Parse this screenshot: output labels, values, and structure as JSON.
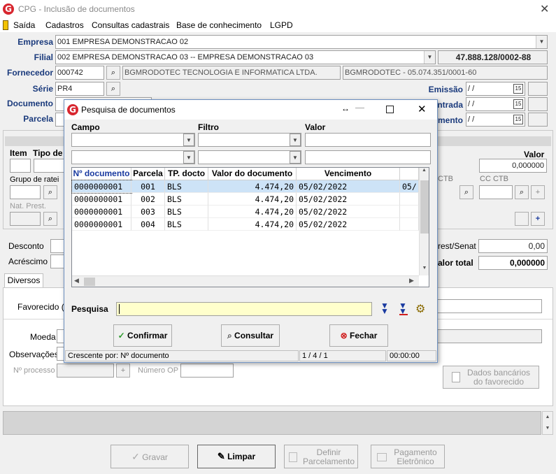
{
  "window": {
    "title": "CPG - Inclusão de documentos"
  },
  "menu": [
    "Saída",
    "Cadastros",
    "Consultas cadastrais",
    "Base de conhecimento",
    "LGPD"
  ],
  "form": {
    "empresa_label": "Empresa",
    "empresa_value": "001 EMPRESA DEMONSTRACAO 02",
    "filial_label": "Filial",
    "filial_value": "002 EMPRESA DEMONSTRACAO 03 -- EMPRESA DEMONSTRACAO 03",
    "filial_cnpj": "47.888.128/0002-88",
    "fornecedor_label": "Fornecedor",
    "fornecedor_code": "000742",
    "fornecedor_name": "BGMRODOTEC TECNOLOGIA E INFORMATICA LTDA.",
    "fornecedor_doc": "BGMRODOTEC - 05.074.351/0001-60",
    "serie_label": "Série",
    "serie_value": "PR4",
    "documento_label": "Documento",
    "parcela_label": "Parcela",
    "emissao_label": "Emissão",
    "entrada_label": "ntrada",
    "vencimento_label": "mento",
    "date_empty": "/ /"
  },
  "items": {
    "item_label": "Item",
    "tipo_label": "Tipo de",
    "valor_label": "Valor",
    "valor_value": "0,000000",
    "grupo_label": "Grupo de ratei",
    "ctb_label": "CTB",
    "cc_ctb_label": "CC CTB",
    "nat_label": "Nat. Prest."
  },
  "totals": {
    "desconto_label": "Desconto",
    "acrescimo_label": "Acréscimo",
    "sest_label": "rest/Senat",
    "sest_value": "0,00",
    "total_label": "alor total",
    "total_value": "0,000000"
  },
  "tabs": {
    "diversos": "Diversos"
  },
  "diversos": {
    "favorecido_label": "Favorecido ( F",
    "moeda_label": "Moeda",
    "obs_label": "Observações",
    "processo_label": "Nº processo",
    "numero_op_label": "Número OP",
    "dados_bancarios": [
      "Dados bancários",
      "do favorecido"
    ]
  },
  "bottom_buttons": {
    "gravar": "Gravar",
    "limpar": "Limpar",
    "definir": [
      "Definir",
      "Parcelamento"
    ],
    "pagamento": [
      "Pagamento",
      "Eletrônico"
    ]
  },
  "dialog": {
    "title": "Pesquisa de documentos",
    "campo_label": "Campo",
    "filtro_label": "Filtro",
    "valor_label": "Valor",
    "columns": [
      "Nº documento",
      "Parcela",
      "TP. docto",
      "Valor do documento",
      "Vencimento",
      ""
    ],
    "rows": [
      [
        "0000000001",
        "001",
        "BLS",
        "4.474,20",
        "05/02/2022",
        "05/"
      ],
      [
        "0000000001",
        "002",
        "BLS",
        "4.474,20",
        "05/02/2022",
        ""
      ],
      [
        "0000000001",
        "003",
        "BLS",
        "4.474,20",
        "05/02/2022",
        ""
      ],
      [
        "0000000001",
        "004",
        "BLS",
        "4.474,20",
        "05/02/2022",
        ""
      ]
    ],
    "pesquisa_label": "Pesquisa",
    "confirmar": "Confirmar",
    "consultar": "Consultar",
    "fechar": "Fechar",
    "status_sort": "Crescente por: Nº documento",
    "status_count": "1 / 4 / 1",
    "status_time": "00:00:00"
  },
  "colors": {
    "label_blue": "#1a3a7c",
    "selection": "#cde3f7",
    "logo_red": "#d8262f",
    "highlight_yellow": "#ffffcc"
  }
}
